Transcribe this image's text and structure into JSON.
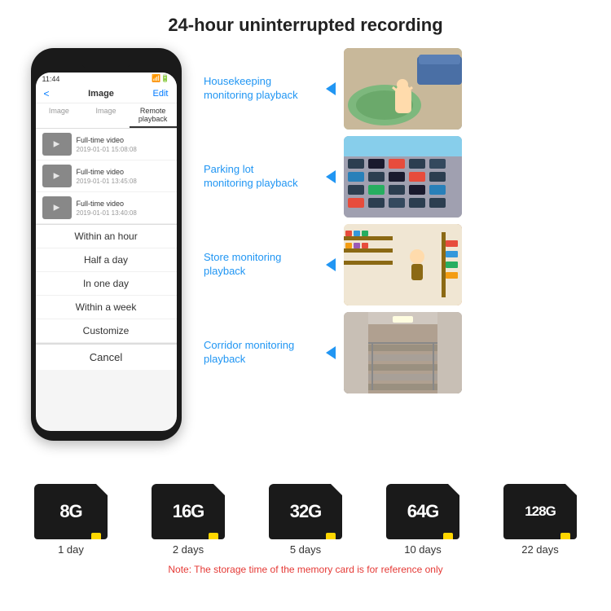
{
  "page": {
    "title": "24-hour uninterrupted recording"
  },
  "phone": {
    "status_time": "11:44",
    "nav_back": "<",
    "nav_title": "Image",
    "nav_edit": "Edit",
    "tab_image": "Image",
    "tab_image2": "Image",
    "tab_remote": "Remote playback",
    "videos": [
      {
        "label": "Full-time video",
        "date": "2019-01-01 15:08:08"
      },
      {
        "label": "Full-time video",
        "date": "2019-01-01 13:45:08"
      },
      {
        "label": "Full-time video",
        "date": "2019-01-01 13:40:08"
      }
    ],
    "dropdown": [
      "Within an hour",
      "Half a day",
      "In one day",
      "Within a week",
      "Customize"
    ],
    "cancel_label": "Cancel"
  },
  "monitoring": [
    {
      "label": "Housekeeping\nmonitoring playback",
      "img_type": "housekeeping"
    },
    {
      "label": "Parking lot\nmonitoring playback",
      "img_type": "parking"
    },
    {
      "label": "Store monitoring\nplayback",
      "img_type": "store"
    },
    {
      "label": "Corridor monitoring\nplayback",
      "img_type": "corridor"
    }
  ],
  "storage": {
    "cards": [
      {
        "size": "8G",
        "days": "1 day"
      },
      {
        "size": "16G",
        "days": "2 days"
      },
      {
        "size": "32G",
        "days": "5 days"
      },
      {
        "size": "64G",
        "days": "10 days"
      },
      {
        "size": "128G",
        "days": "22 days"
      }
    ],
    "note": "Note: The storage time of the memory card is for reference only"
  }
}
